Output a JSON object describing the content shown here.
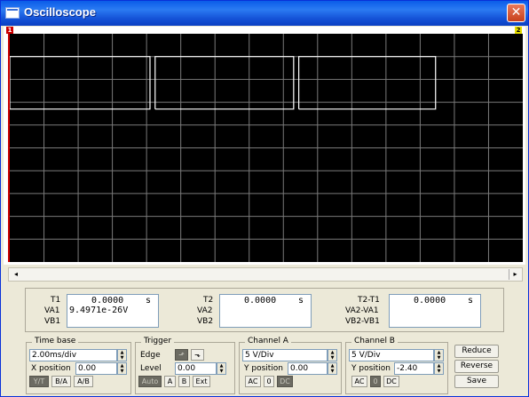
{
  "window": {
    "title": "Oscilloscope",
    "close_label": "✕",
    "title_bar_color": "#1553d8"
  },
  "screen": {
    "background": "#000000",
    "grid_color": "#7a7a7a",
    "trace_color": "#ffffff",
    "markers": [
      {
        "name": "cursor-t1-marker",
        "label": "1",
        "edge": "left",
        "color": "#cc0000"
      },
      {
        "name": "cursor-t2-marker",
        "label": "2",
        "edge": "right",
        "color": "#e8e000"
      }
    ],
    "grid": {
      "cols": 15,
      "rows": 10
    },
    "waveform": {
      "high_div_from_top": 1.0,
      "low_div_from_top": 3.3,
      "pulse_intervals_div": [
        [
          0.0,
          4.1
        ],
        [
          4.25,
          8.3
        ],
        [
          8.45,
          12.45
        ]
      ]
    }
  },
  "scrollbar": {
    "left_arrow": "◂",
    "right_arrow": "▸"
  },
  "cursors": {
    "t1_label": "T1",
    "va1_label": "VA1",
    "vb1_label": "VB1",
    "t1_value": "0.0000",
    "t1_unit": "s",
    "va1_value": "9.4971e-26V",
    "vb1_value": "",
    "t2_label": "T2",
    "va2_label": "VA2",
    "vb2_label": "VB2",
    "t2_value": "0.0000",
    "t2_unit": "s",
    "va2_value": "",
    "vb2_value": "",
    "dt_label": "T2-T1",
    "dva_label": "VA2-VA1",
    "dvb_label": "VB2-VB1",
    "dt_value": "0.0000",
    "dt_unit": "s",
    "dva_value": "",
    "dvb_value": ""
  },
  "timebase": {
    "title": "Time base",
    "scale": "2.00ms/div",
    "xpos_label": "X position",
    "xpos": "0.00",
    "modes": [
      "Y/T",
      "B/A",
      "A/B"
    ],
    "active_mode": "Y/T"
  },
  "trigger": {
    "title": "Trigger",
    "edge_label": "Edge",
    "edge_rising": "⬏",
    "edge_falling": "⬎",
    "level_label": "Level",
    "level": "0.00",
    "sources": [
      "Auto",
      "A",
      "B",
      "Ext"
    ],
    "active_source": "Auto"
  },
  "channel_a": {
    "title": "Channel A",
    "scale": "5 V/Div",
    "ypos_label": "Y position",
    "ypos": "0.00",
    "coupling": [
      "AC",
      "0",
      "DC"
    ],
    "active_coupling": "DC"
  },
  "channel_b": {
    "title": "Channel B",
    "scale": "5 V/Div",
    "ypos_label": "Y position",
    "ypos": "-2.40",
    "coupling": [
      "AC",
      "0",
      "DC"
    ],
    "active_coupling": "0"
  },
  "actions": {
    "reduce": "Reduce",
    "reverse": "Reverse",
    "save": "Save"
  }
}
